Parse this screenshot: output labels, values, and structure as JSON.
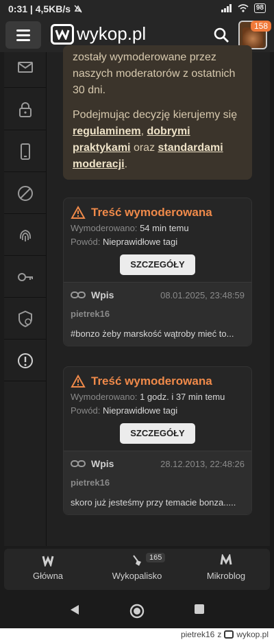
{
  "status_bar": {
    "time_speed": "0:31 | 4,5KB/s",
    "battery": "98"
  },
  "header": {
    "logo_text": "wykop.pl",
    "notification_count": "158",
    "icons": [
      "menu-icon",
      "search-icon"
    ]
  },
  "sidebar": {
    "icons": [
      "mail-icon",
      "lock-icon",
      "phone-icon",
      "block-icon",
      "fingerprint-icon",
      "key-icon",
      "shield-user-icon",
      "alert-icon"
    ]
  },
  "info": {
    "line1": "zostały wymoderowane przez naszych moderatorów z ostatnich 30 dni.",
    "line2_prefix": "Podejmując decyzję kierujemy się",
    "link1": "regulaminem",
    "sep1": ",",
    "link2": "dobrymi praktykami",
    "sep2": "oraz",
    "link3": "standardami moderacji",
    "end": "."
  },
  "cards": [
    {
      "title": "Treść wymoderowana",
      "moderated_label": "Wymoderowano:",
      "moderated_value": "54 min temu",
      "reason_label": "Powód:",
      "reason_value": "Nieprawidłowe tagi",
      "button": "SZCZEGÓŁY",
      "entry_type": "Wpis",
      "entry_date": "08.01.2025, 23:48:59",
      "author": "pietrek16",
      "text": "#bonzo żeby marskość wątroby mieć to..."
    },
    {
      "title": "Treść wymoderowana",
      "moderated_label": "Wymoderowano:",
      "moderated_value": "1 godz. i 37 min temu",
      "reason_label": "Powód:",
      "reason_value": "Nieprawidłowe tagi",
      "button": "SZCZEGÓŁY",
      "entry_type": "Wpis",
      "entry_date": "28.12.2013, 22:48:26",
      "author": "pietrek16",
      "text": "skoro już jesteśmy przy temacie bonza....."
    }
  ],
  "bottom_nav": [
    {
      "label": "Główna"
    },
    {
      "label": "Wykopalisko",
      "badge": "165"
    },
    {
      "label": "Mikroblog"
    }
  ],
  "footer": {
    "user": "pietrek16",
    "z": "z",
    "site": "wykop.pl"
  },
  "colors": {
    "accent": "#f08a4a",
    "info_bg": "#3b342b"
  }
}
